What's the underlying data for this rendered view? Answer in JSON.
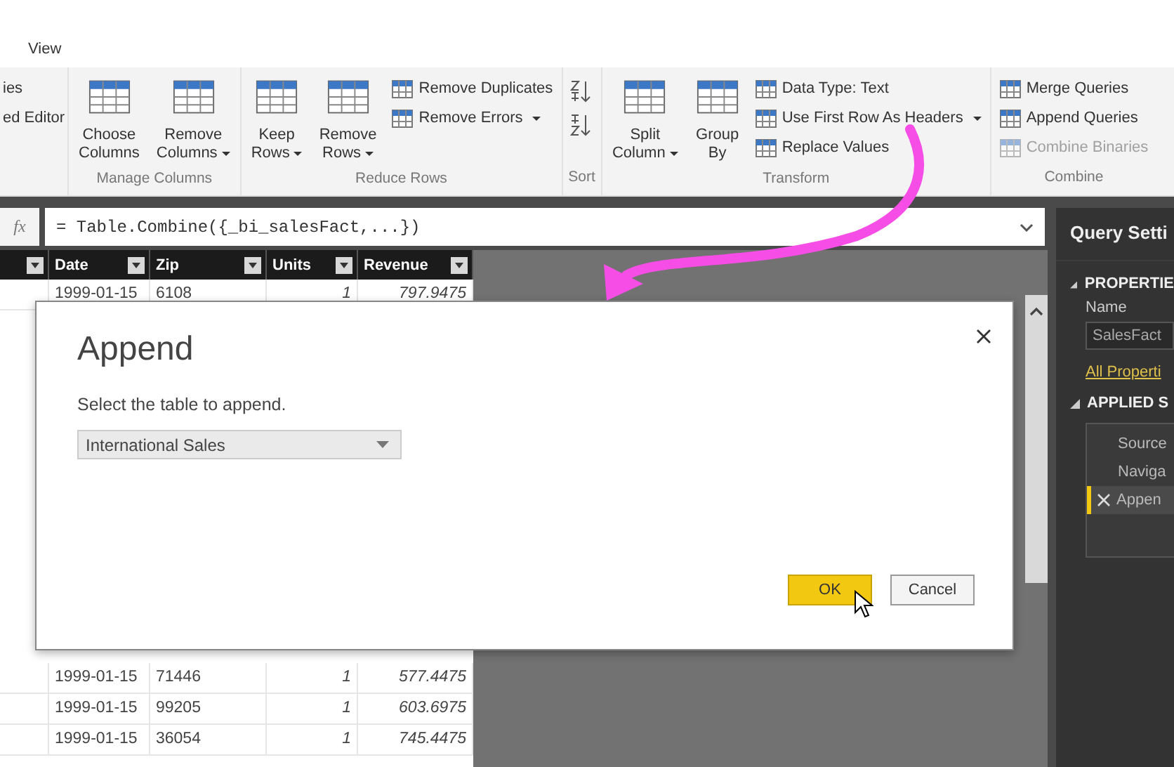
{
  "ribbon": {
    "tab": "View",
    "groups": [
      {
        "items": [
          {
            "kind": "text",
            "label": "ies"
          },
          {
            "kind": "text",
            "label": "ed Editor"
          }
        ]
      },
      {
        "label": "Manage Columns",
        "items": [
          {
            "kind": "large",
            "lines": [
              "Choose",
              "Columns"
            ],
            "dropdown": false
          },
          {
            "kind": "large",
            "lines": [
              "Remove",
              "Columns"
            ],
            "dropdown": true
          }
        ]
      },
      {
        "label": "Reduce Rows",
        "items": [
          {
            "kind": "large",
            "lines": [
              "Keep",
              "Rows"
            ],
            "dropdown": true
          },
          {
            "kind": "large",
            "lines": [
              "Remove",
              "Rows"
            ],
            "dropdown": true
          },
          {
            "kind": "small",
            "label": "Remove Duplicates",
            "dropdown": false,
            "disabled": false
          },
          {
            "kind": "small",
            "label": "Remove Errors",
            "dropdown": true,
            "disabled": false
          }
        ]
      },
      {
        "label": "Sort",
        "items": [
          {
            "kind": "sort"
          }
        ]
      },
      {
        "label": "Transform",
        "items": [
          {
            "kind": "large",
            "lines": [
              "Split",
              "Column"
            ],
            "dropdown": true
          },
          {
            "kind": "large",
            "lines": [
              "Group",
              "By"
            ],
            "dropdown": false
          },
          {
            "kind": "small",
            "label": "Data Type: Text",
            "dropdown": false,
            "disabled": false
          },
          {
            "kind": "small",
            "label": "Use First Row As Headers",
            "dropdown": true,
            "disabled": false
          },
          {
            "kind": "small",
            "label": "Replace Values",
            "dropdown": false,
            "disabled": false
          }
        ]
      },
      {
        "label": "Combine",
        "items": [
          {
            "kind": "small",
            "label": "Merge Queries",
            "dropdown": false,
            "disabled": false
          },
          {
            "kind": "small",
            "label": "Append Queries",
            "dropdown": false,
            "disabled": false
          },
          {
            "kind": "small",
            "label": "Combine Binaries",
            "dropdown": false,
            "disabled": true
          }
        ]
      }
    ]
  },
  "formula_bar": {
    "fx": "fx",
    "formula": "= Table.Combine({_bi_salesFact,...})"
  },
  "table": {
    "columns": [
      "Date",
      "Zip",
      "Units",
      "Revenue"
    ],
    "rows_top": [
      {
        "cells": [
          "1999-01-15",
          "6108",
          "1",
          "797.9475"
        ]
      }
    ],
    "rows_bottom": [
      {
        "cells": [
          "1999-01-15",
          "71446",
          "1",
          "577.4475"
        ]
      },
      {
        "cells": [
          "1999-01-15",
          "99205",
          "1",
          "603.6975"
        ]
      },
      {
        "cells": [
          "1999-01-15",
          "36054",
          "1",
          "745.4475"
        ]
      }
    ]
  },
  "query_settings": {
    "title": "Query Setti",
    "properties_heading": "PROPERTIE",
    "name_label": "Name",
    "name_value": "SalesFact",
    "link": "All Properti",
    "steps_heading": "APPLIED S",
    "steps": [
      {
        "label": "Source",
        "selected": false
      },
      {
        "label": "Naviga",
        "selected": false
      },
      {
        "label": "Appen",
        "selected": true
      }
    ]
  },
  "dialog": {
    "title": "Append",
    "prompt": "Select the table to append.",
    "table_select": {
      "value": "International Sales"
    },
    "buttons": [
      {
        "label": "OK",
        "primary": true
      },
      {
        "label": "Cancel",
        "primary": false
      }
    ]
  }
}
